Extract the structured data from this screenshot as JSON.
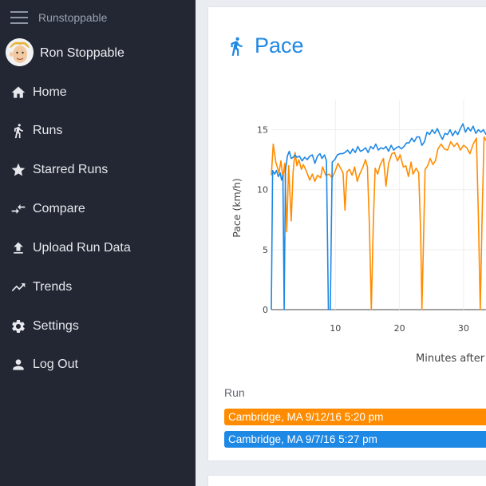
{
  "app": {
    "title": "Runstoppable"
  },
  "user": {
    "name": "Ron Stoppable"
  },
  "sidebar": {
    "items": [
      {
        "label": "Home",
        "icon": "home-icon"
      },
      {
        "label": "Runs",
        "icon": "runner-icon"
      },
      {
        "label": "Starred Runs",
        "icon": "star-icon"
      },
      {
        "label": "Compare",
        "icon": "compare-icon"
      },
      {
        "label": "Upload Run Data",
        "icon": "upload-icon"
      },
      {
        "label": "Trends",
        "icon": "trend-icon"
      },
      {
        "label": "Settings",
        "icon": "gear-icon"
      },
      {
        "label": "Log Out",
        "icon": "person-icon"
      }
    ]
  },
  "card": {
    "title": "Pace",
    "icon": "runner-icon"
  },
  "colors": {
    "accent": "#1e88e5",
    "orange": "#ff8c00",
    "blue": "#1e88e5",
    "sidebar": "#232734"
  },
  "chart_data": {
    "type": "line",
    "xlabel": "Minutes after",
    "ylabel": "Pace (km/h)",
    "yticks": [
      0,
      5,
      10,
      15
    ],
    "xticks": [
      10,
      20,
      30
    ],
    "ylim": [
      0,
      17.5
    ],
    "xlim": [
      0,
      33.5
    ],
    "grid": true,
    "series": [
      {
        "name": "Cambridge, MA 9/12/16 5:20 pm",
        "color": "#ff8c00",
        "points": [
          [
            0.0,
            11.2
          ],
          [
            0.3,
            13.8
          ],
          [
            0.7,
            12.3
          ],
          [
            1.2,
            11.4
          ],
          [
            1.5,
            12.4
          ],
          [
            1.8,
            11.0
          ],
          [
            2.1,
            12.2
          ],
          [
            2.4,
            6.5
          ],
          [
            2.7,
            12.0
          ],
          [
            3.1,
            7.4
          ],
          [
            3.4,
            11.5
          ],
          [
            3.7,
            13.1
          ],
          [
            4.0,
            12.0
          ],
          [
            4.3,
            12.5
          ],
          [
            4.7,
            11.7
          ],
          [
            5.0,
            12.1
          ],
          [
            5.5,
            11.5
          ],
          [
            6.0,
            10.8
          ],
          [
            6.4,
            11.3
          ],
          [
            6.8,
            10.7
          ],
          [
            7.2,
            11.2
          ],
          [
            7.7,
            11.0
          ],
          [
            8.0,
            11.9
          ],
          [
            8.5,
            11.2
          ],
          [
            9.0,
            11.3
          ],
          [
            9.5,
            11.0
          ],
          [
            10.0,
            11.6
          ],
          [
            10.4,
            12.2
          ],
          [
            10.8,
            11.8
          ],
          [
            11.2,
            11.4
          ],
          [
            11.5,
            8.3
          ],
          [
            11.8,
            11.5
          ],
          [
            12.2,
            11.7
          ],
          [
            12.6,
            11.2
          ],
          [
            13.0,
            11.9
          ],
          [
            13.4,
            10.7
          ],
          [
            13.8,
            11.3
          ],
          [
            14.3,
            11.9
          ],
          [
            14.7,
            12.5
          ],
          [
            15.0,
            11.9
          ],
          [
            15.3,
            7.0
          ],
          [
            15.6,
            0.0
          ],
          [
            15.9,
            7.0
          ],
          [
            16.2,
            11.8
          ],
          [
            16.6,
            11.3
          ],
          [
            17.0,
            12.1
          ],
          [
            17.5,
            12.6
          ],
          [
            17.9,
            10.3
          ],
          [
            18.3,
            12.2
          ],
          [
            18.8,
            13.0
          ],
          [
            19.2,
            13.1
          ],
          [
            19.7,
            12.4
          ],
          [
            20.1,
            12.9
          ],
          [
            20.6,
            11.9
          ],
          [
            21.0,
            12.0
          ],
          [
            21.4,
            11.1
          ],
          [
            21.8,
            12.3
          ],
          [
            22.1,
            11.3
          ],
          [
            22.6,
            11.8
          ],
          [
            23.0,
            11.4
          ],
          [
            23.3,
            6.5
          ],
          [
            23.5,
            0.0
          ],
          [
            23.8,
            7.0
          ],
          [
            24.0,
            11.7
          ],
          [
            24.4,
            12.0
          ],
          [
            24.8,
            12.6
          ],
          [
            25.2,
            12.1
          ],
          [
            25.6,
            12.4
          ],
          [
            26.0,
            13.4
          ],
          [
            26.5,
            13.8
          ],
          [
            27.0,
            13.4
          ],
          [
            27.5,
            13.3
          ],
          [
            28.0,
            14.0
          ],
          [
            28.5,
            13.6
          ],
          [
            29.0,
            13.9
          ],
          [
            29.5,
            13.3
          ],
          [
            30.0,
            13.7
          ],
          [
            30.5,
            13.5
          ],
          [
            31.0,
            13.0
          ],
          [
            31.5,
            13.8
          ],
          [
            32.0,
            14.3
          ],
          [
            32.3,
            8.0
          ],
          [
            32.6,
            0.0
          ],
          [
            32.9,
            8.0
          ],
          [
            33.2,
            14.4
          ],
          [
            33.5,
            14.1
          ]
        ]
      },
      {
        "name": "Cambridge, MA 9/7/16 5:27 pm",
        "color": "#1e88e5",
        "points": [
          [
            0.0,
            0.0
          ],
          [
            0.2,
            11.6
          ],
          [
            0.5,
            11.3
          ],
          [
            0.8,
            11.6
          ],
          [
            1.1,
            11.1
          ],
          [
            1.4,
            11.4
          ],
          [
            1.6,
            10.8
          ],
          [
            1.8,
            11.2
          ],
          [
            2.0,
            0.0
          ],
          [
            2.2,
            11.6
          ],
          [
            2.5,
            12.8
          ],
          [
            2.8,
            13.2
          ],
          [
            3.1,
            12.6
          ],
          [
            3.4,
            12.7
          ],
          [
            3.7,
            12.9
          ],
          [
            4.0,
            12.7
          ],
          [
            4.4,
            12.8
          ],
          [
            4.8,
            12.4
          ],
          [
            5.2,
            12.7
          ],
          [
            5.6,
            12.5
          ],
          [
            6.0,
            12.8
          ],
          [
            6.4,
            12.9
          ],
          [
            6.8,
            12.2
          ],
          [
            7.2,
            12.8
          ],
          [
            7.6,
            13.0
          ],
          [
            7.9,
            12.6
          ],
          [
            8.3,
            12.9
          ],
          [
            8.6,
            12.4
          ],
          [
            8.9,
            0.0
          ],
          [
            9.2,
            0.0
          ],
          [
            9.5,
            12.3
          ],
          [
            9.9,
            12.5
          ],
          [
            10.3,
            12.9
          ],
          [
            10.7,
            13.0
          ],
          [
            11.1,
            13.0
          ],
          [
            11.5,
            13.1
          ],
          [
            11.9,
            13.3
          ],
          [
            12.3,
            13.0
          ],
          [
            12.7,
            13.4
          ],
          [
            13.1,
            13.1
          ],
          [
            13.5,
            13.6
          ],
          [
            13.9,
            13.2
          ],
          [
            14.3,
            13.3
          ],
          [
            14.7,
            13.5
          ],
          [
            15.1,
            13.1
          ],
          [
            15.5,
            13.6
          ],
          [
            15.9,
            13.4
          ],
          [
            16.3,
            13.8
          ],
          [
            16.7,
            13.3
          ],
          [
            17.1,
            13.5
          ],
          [
            17.5,
            13.4
          ],
          [
            17.9,
            13.6
          ],
          [
            18.3,
            13.2
          ],
          [
            18.7,
            13.7
          ],
          [
            19.1,
            13.3
          ],
          [
            19.5,
            13.5
          ],
          [
            19.9,
            13.6
          ],
          [
            20.3,
            13.4
          ],
          [
            20.7,
            13.6
          ],
          [
            21.1,
            13.9
          ],
          [
            21.5,
            13.9
          ],
          [
            21.9,
            14.3
          ],
          [
            22.3,
            14.0
          ],
          [
            22.7,
            14.4
          ],
          [
            23.1,
            14.4
          ],
          [
            23.5,
            13.7
          ],
          [
            23.9,
            14.0
          ],
          [
            24.3,
            14.8
          ],
          [
            24.7,
            14.6
          ],
          [
            25.1,
            15.0
          ],
          [
            25.5,
            14.7
          ],
          [
            25.9,
            15.1
          ],
          [
            26.3,
            14.6
          ],
          [
            26.7,
            14.2
          ],
          [
            27.1,
            14.7
          ],
          [
            27.5,
            14.6
          ],
          [
            27.9,
            15.0
          ],
          [
            28.3,
            14.5
          ],
          [
            28.7,
            14.9
          ],
          [
            29.1,
            14.6
          ],
          [
            29.5,
            15.1
          ],
          [
            29.9,
            15.5
          ],
          [
            30.3,
            14.8
          ],
          [
            30.7,
            15.2
          ],
          [
            31.1,
            14.9
          ],
          [
            31.5,
            15.3
          ],
          [
            31.9,
            14.7
          ],
          [
            32.3,
            15.0
          ],
          [
            32.7,
            14.8
          ],
          [
            33.1,
            15.0
          ],
          [
            33.5,
            14.6
          ]
        ]
      }
    ]
  },
  "runs": {
    "label": "Run",
    "items": [
      {
        "label": "Cambridge, MA 9/12/16 5:20 pm",
        "color": "#ff8c00"
      },
      {
        "label": "Cambridge, MA 9/7/16 5:27 pm",
        "color": "#1e88e5"
      }
    ]
  }
}
